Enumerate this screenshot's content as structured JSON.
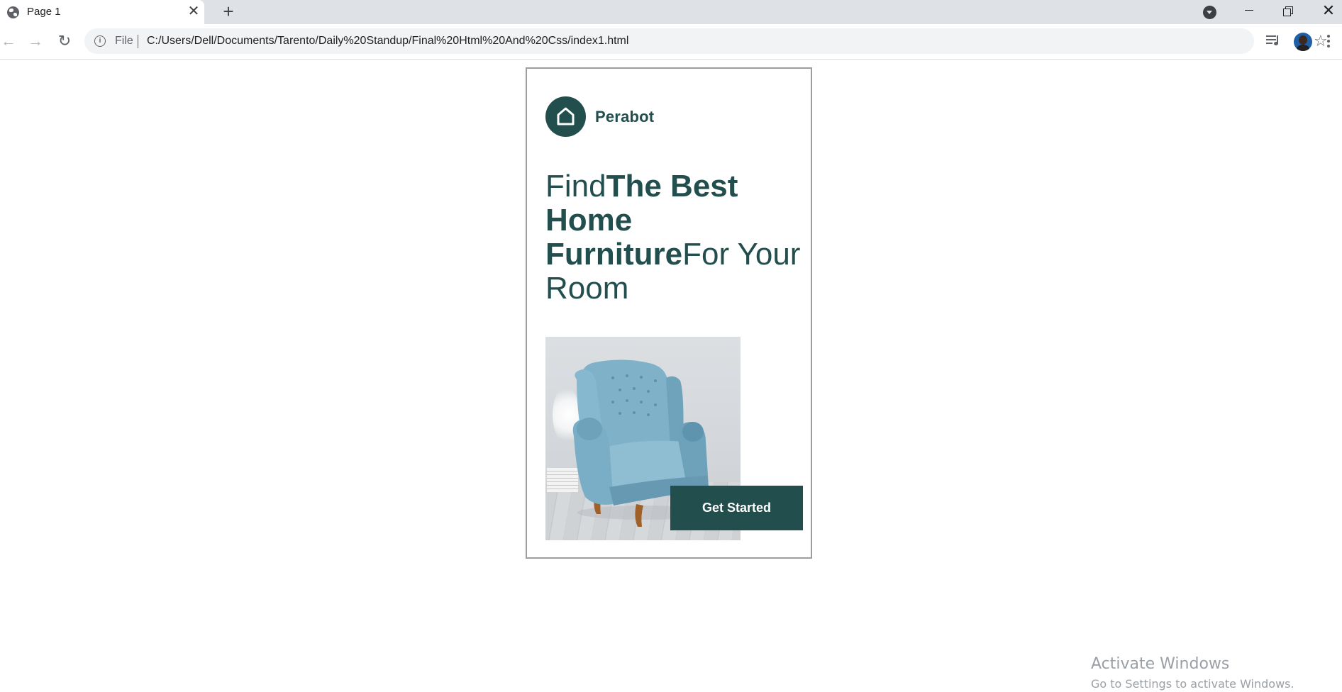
{
  "browser": {
    "tab": {
      "title": "Page 1",
      "close_glyph": "✕"
    },
    "new_tab_glyph": "+",
    "address": {
      "scheme_label": "File",
      "url": "C:/Users/Dell/Documents/Tarento/Daily%20Standup/Final%20Html%20And%20Css/index1.html"
    },
    "icons": {
      "back": "←",
      "forward": "→",
      "reload": "↻",
      "info": "i",
      "star": "☆",
      "window_close": "✕"
    }
  },
  "page": {
    "brand_name": "Perabot",
    "headline": {
      "part1": "Find",
      "bold": "The Best Home Furniture",
      "part2": "For Your Room"
    },
    "cta_label": "Get Started",
    "accent_color": "#224e4e"
  },
  "watermark": {
    "title": "Activate Windows",
    "subtitle": "Go to Settings to activate Windows."
  }
}
